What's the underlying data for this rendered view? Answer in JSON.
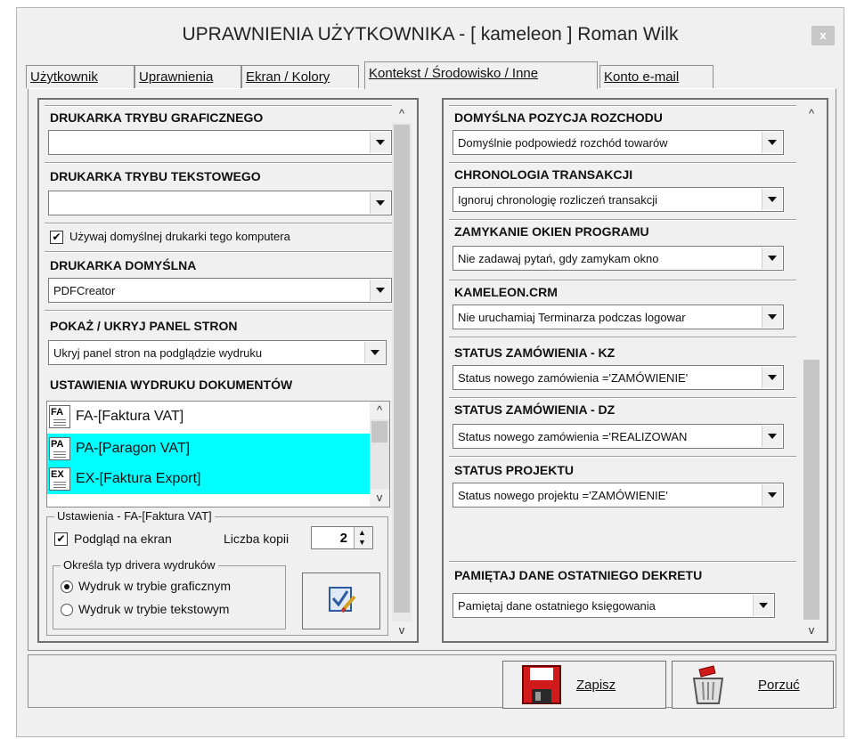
{
  "window": {
    "title": "UPRAWNIENIA UŻYTKOWNIKA - [ kameleon ] Roman Wilk",
    "close_label": "x"
  },
  "tabs": [
    {
      "label": "Użytkownik"
    },
    {
      "label": "Uprawnienia"
    },
    {
      "label": "Ekran / Kolory"
    },
    {
      "label": "Kontekst / Środowisko / Inne",
      "active": true
    },
    {
      "label": "Konto e-mail"
    }
  ],
  "left": {
    "graphic_printer": {
      "label": "DRUKARKA TRYBU GRAFICZNEGO",
      "value": ""
    },
    "text_printer": {
      "label": "DRUKARKA TRYBU TEKSTOWEGO",
      "value": ""
    },
    "use_default_printer": {
      "label": "Używaj domyślnej drukarki  tego komputera",
      "checked": true
    },
    "default_printer": {
      "label": "DRUKARKA DOMYŚLNA",
      "value": "PDFCreator"
    },
    "page_panel": {
      "label": "POKAŻ / UKRYJ PANEL STRON",
      "value": "Ukryj panel stron na podglądzie wydruku"
    },
    "print_settings": {
      "label": "USTAWIENIA WYDRUKU DOKUMENTÓW",
      "documents": [
        {
          "icon": "FA",
          "label": "FA-[Faktura VAT]",
          "selected": false
        },
        {
          "icon": "PA",
          "label": "PA-[Paragon VAT]",
          "selected": true
        },
        {
          "icon": "EX",
          "label": "EX-[Faktura Export]",
          "selected": true
        }
      ],
      "selection_color": "#00ffff"
    },
    "doc_settings": {
      "title": "Ustawienia - FA-[Faktura VAT]",
      "preview_label": "Podgląd na ekran",
      "preview_checked": true,
      "copies_label": "Liczba kopii",
      "copies_value": "2",
      "driver_group_title": "Określa typ drivera wydruków",
      "driver_options": [
        {
          "label": "Wydruk w trybie graficznym",
          "selected": true
        },
        {
          "label": "Wydruk w trybie tekstowym",
          "selected": false
        }
      ]
    }
  },
  "right": {
    "sections": [
      {
        "label": "DOMYŚLNA POZYCJA ROZCHODU",
        "value": "Domyślnie podpowiedź rozchód towarów"
      },
      {
        "label": "CHRONOLOGIA TRANSAKCJI",
        "value": "Ignoruj chronologię rozliczeń transakcji"
      },
      {
        "label": "ZAMYKANIE OKIEN PROGRAMU",
        "value": "Nie zadawaj pytań, gdy zamykam okno"
      },
      {
        "label": "KAMELEON.CRM",
        "value": "Nie uruchamiaj Terminarza podczas logowar"
      },
      {
        "label": "STATUS ZAMÓWIENIA - KZ",
        "value": "Status nowego zamówienia ='ZAMÓWIENIE'"
      },
      {
        "label": "STATUS ZAMÓWIENIA - DZ",
        "value": "Status nowego zamówienia ='REALIZOWAN"
      },
      {
        "label": "STATUS PROJEKTU",
        "value": "Status nowego projektu ='ZAMÓWIENIE'"
      }
    ],
    "last_entry": {
      "label": "PAMIĘTAJ DANE OSTATNIEGO DEKRETU",
      "value": "Pamiętaj dane ostatniego księgowania"
    }
  },
  "footer": {
    "save_label": "Zapisz",
    "cancel_label": "Porzuć"
  }
}
